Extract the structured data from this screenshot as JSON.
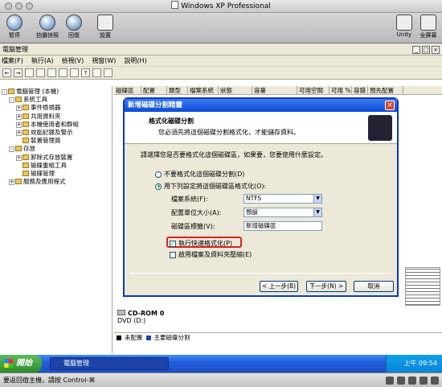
{
  "mac_window": {
    "title": "Windows XP Professional"
  },
  "mac_toolbar": {
    "pause": "暫停",
    "snapshot": "拍攝快照",
    "revert": "回復",
    "settings": "設置",
    "unity": "Unity",
    "fullscreen": "全屏幕"
  },
  "xp_window": {
    "title": "電腦管理"
  },
  "menu": [
    "檔案(F)",
    "執行(A)",
    "檢視(V)",
    "視窗(W)",
    "說明(H)"
  ],
  "tree": [
    {
      "t": "電腦管理 (本機)",
      "d": 0,
      "b": "-"
    },
    {
      "t": "系統工具",
      "d": 1,
      "b": "-"
    },
    {
      "t": "事件檢視器",
      "d": 2,
      "b": "+"
    },
    {
      "t": "共用資料夾",
      "d": 2,
      "b": "+"
    },
    {
      "t": "本機使用者和群組",
      "d": 2,
      "b": "+"
    },
    {
      "t": "效能記錄及警示",
      "d": 2,
      "b": "+"
    },
    {
      "t": "裝置管理員",
      "d": 2,
      "b": ""
    },
    {
      "t": "存放",
      "d": 1,
      "b": "-"
    },
    {
      "t": "卸除式存放裝置",
      "d": 2,
      "b": "+"
    },
    {
      "t": "磁碟重組工具",
      "d": 2,
      "b": ""
    },
    {
      "t": "磁碟管理",
      "d": 2,
      "b": ""
    },
    {
      "t": "服務及應用程式",
      "d": 1,
      "b": "+"
    }
  ],
  "columns": [
    "磁碟區",
    "配置",
    "類型",
    "檔案系統",
    "狀態",
    "容量",
    "可用空間",
    "可用 %",
    "容錯",
    "預先配置"
  ],
  "disk": {
    "name": "CD-ROM 0",
    "type": "DVD (D:)"
  },
  "legend": {
    "unallocated": "未配置",
    "primary": "主要磁碟分割"
  },
  "dialog": {
    "title": "新增磁碟分割精靈",
    "header_title": "格式化磁碟分割",
    "header_sub": "您必須先將這個磁碟分割格式化，才能儲存資料。",
    "prompt": "請選擇您是否要格式化這個磁碟區，如果要，您要使用什麼設定。",
    "opt_noformat": "不要格式化這個磁碟分割(D)",
    "opt_format": "用下列設定將這個磁碟區格式化(O):",
    "fs_label": "檔案系統(F):",
    "fs_value": "NTFS",
    "alloc_label": "配置單位大小(A):",
    "alloc_value": "預設",
    "vol_label": "磁碟區標籤(V):",
    "vol_value": "新增磁碟區",
    "quick": "執行快速格式化(P)",
    "compress": "啟用檔案及資料夾壓縮(E)",
    "back": "< 上一步(B)",
    "next": "下一步(N) >",
    "cancel": "取消"
  },
  "taskbar": {
    "start": "開始",
    "task": "電腦管理",
    "clock": "上午 09:54"
  },
  "status": {
    "text": "要返回宿主機，請按 Control-⌘"
  }
}
